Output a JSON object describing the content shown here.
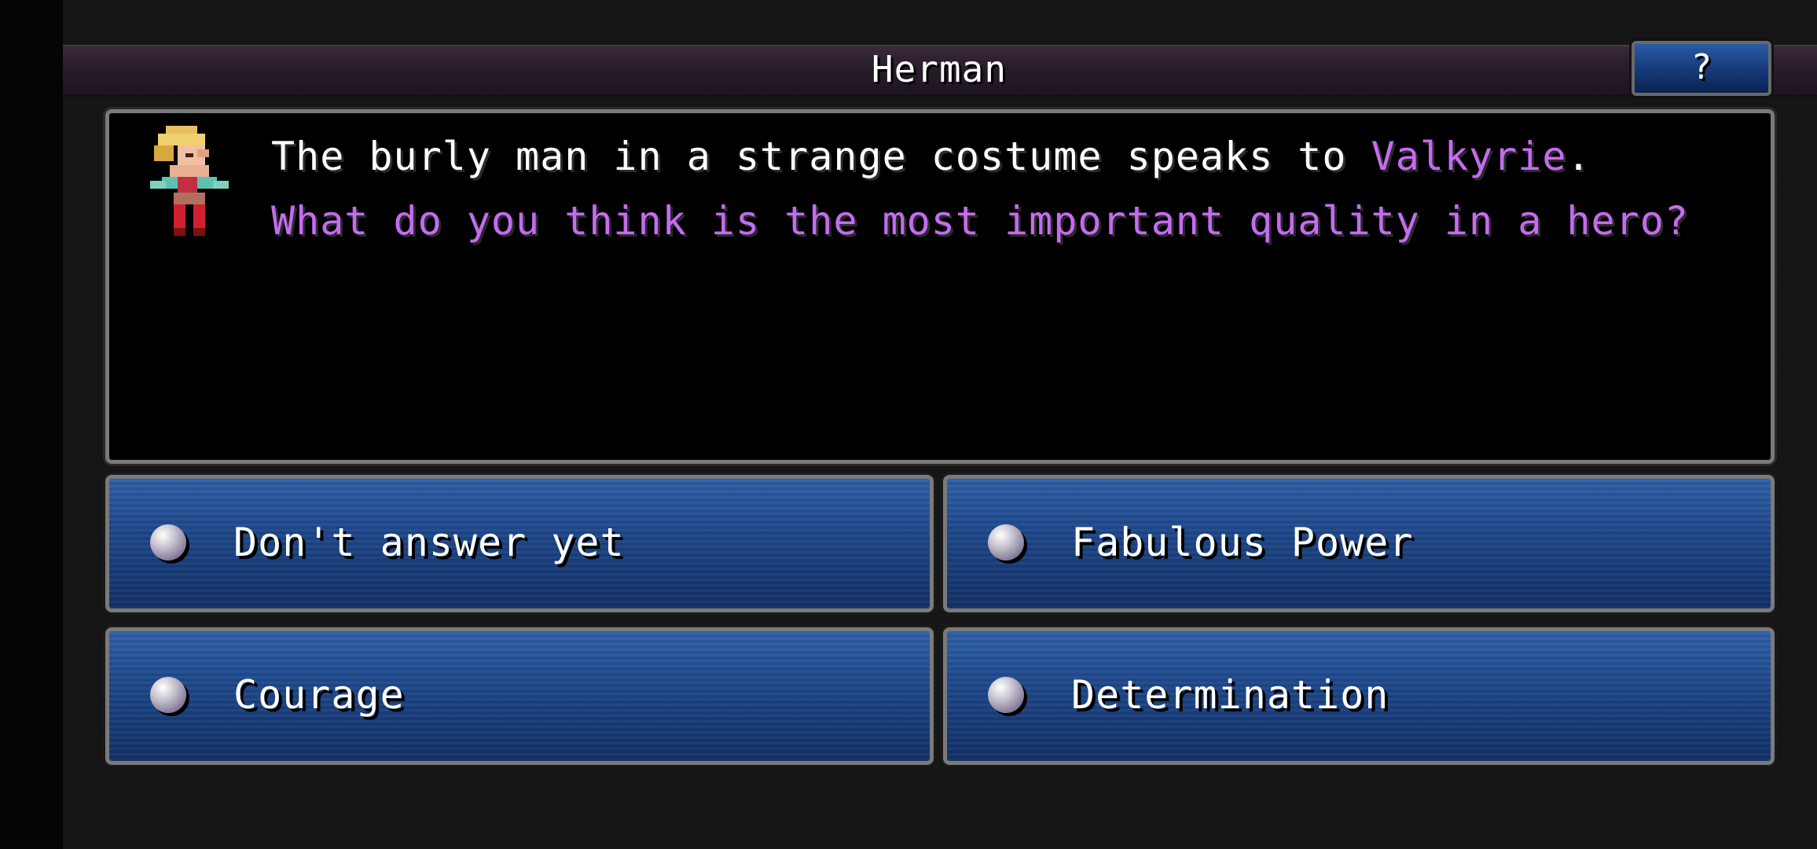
{
  "header": {
    "title": "Herman",
    "help_label": "?"
  },
  "dialog": {
    "line1_prefix": "The burly man in a strange costume speaks to ",
    "speaker": "Valkyrie",
    "line1_suffix": ".",
    "line2": "What do you think is the most important quality in a hero?"
  },
  "choices": [
    {
      "label": "Don't answer yet"
    },
    {
      "label": "Fabulous Power"
    },
    {
      "label": "Courage"
    },
    {
      "label": "Determination"
    }
  ],
  "colors": {
    "highlight": "#c46cf0",
    "choice_blue": "#1d4688",
    "title_bar": "#2a1d2c"
  },
  "icons": {
    "portrait": "pixel-character-portrait",
    "bullet": "orb-bullet-icon"
  }
}
